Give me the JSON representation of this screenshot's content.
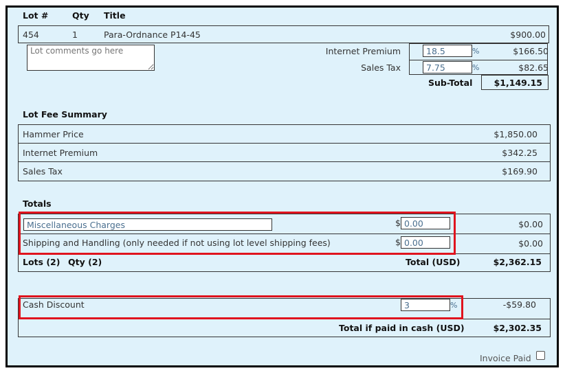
{
  "header": {
    "lot_col": "Lot #",
    "qty_col": "Qty",
    "title_col": "Title"
  },
  "lot": {
    "number": "454",
    "qty": "1",
    "title": "Para-Ordnance P14-45",
    "price": "$900.00",
    "comments_placeholder": "Lot comments go here",
    "premium_label": "Internet Premium",
    "premium_pct": "18.5",
    "premium_unit": "%",
    "premium_amount": "$166.50",
    "tax_label": "Sales Tax",
    "tax_pct": "7.75",
    "tax_unit": "%",
    "tax_amount": "$82.65",
    "subtotal_label": "Sub-Total",
    "subtotal": "$1,149.15"
  },
  "fee_summary": {
    "title": "Lot Fee Summary",
    "rows": [
      {
        "label": "Hammer Price",
        "amount": "$1,850.00"
      },
      {
        "label": "Internet Premium",
        "amount": "$342.25"
      },
      {
        "label": "Sales Tax",
        "amount": "$169.90"
      }
    ]
  },
  "totals": {
    "title": "Totals",
    "misc_label": "Miscellaneous Charges",
    "misc_currency": "$",
    "misc_value": "0.00",
    "misc_amount": "$0.00",
    "ship_label": "Shipping and Handling (only needed if not using lot level shipping fees)",
    "ship_currency": "$",
    "ship_value": "0.00",
    "ship_amount": "$0.00",
    "lots_label": "Lots (2)",
    "qty_label": "Qty (2)",
    "total_label": "Total (USD)",
    "total": "$2,362.15"
  },
  "cash": {
    "label": "Cash Discount",
    "pct": "3",
    "unit": "%",
    "amount": "-$59.80",
    "total_label": "Total if paid in cash (USD)",
    "total": "$2,302.35"
  },
  "invoice_paid_label": "Invoice Paid",
  "colors": {
    "background": "#dff2fb",
    "highlight": "#e0141e",
    "input_text": "#4a6f8f"
  }
}
